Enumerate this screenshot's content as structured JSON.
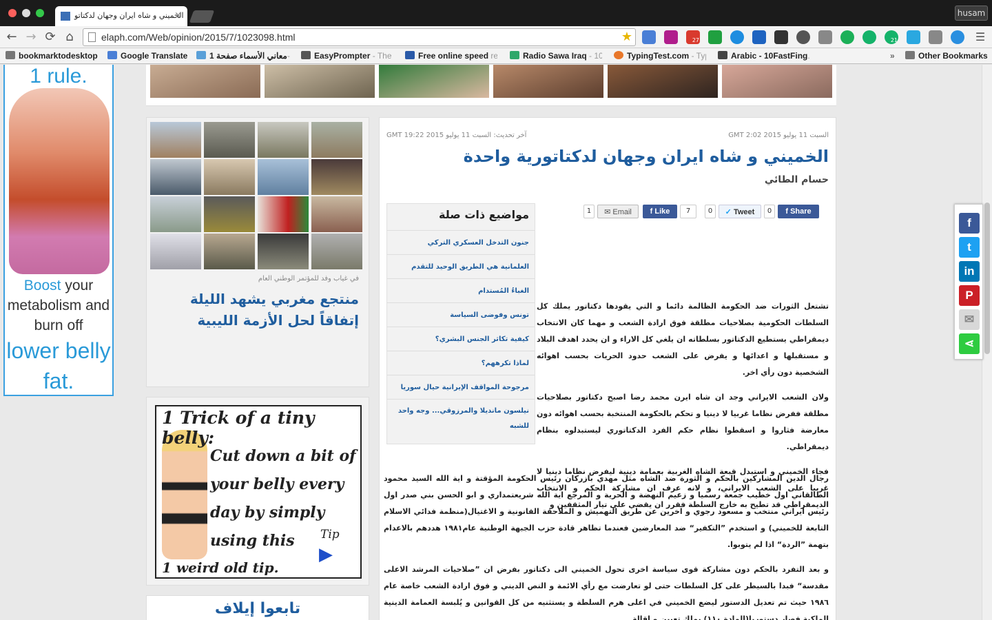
{
  "browser": {
    "tab_title": "الخميني و شاه ايران وجهان لدكتاتو",
    "tab_close": "×",
    "user_button": "husam",
    "url": "elaph.com/Web/opinion/2015/7/1023098.html",
    "back_glyph": "←",
    "forward_glyph": "→",
    "reload_glyph": "⟳",
    "home_glyph": "⌂",
    "star_glyph": "★",
    "extension_badges": {
      "gmail": "27",
      "grammarly": "21"
    },
    "icons": [
      "back-icon",
      "forward-icon",
      "reload-icon",
      "home-icon",
      "bookmark-star-icon",
      "menu-icon"
    ]
  },
  "bookmarks": {
    "items": [
      {
        "label": "bookmarktodesktop",
        "dim": ""
      },
      {
        "label": "Google Translate",
        "dim": ""
      },
      {
        "label": "معاني الأسماء صفحة 1",
        "dim": "- ..."
      },
      {
        "label": "EasyPrompter",
        "dim": " - The"
      },
      {
        "label": "Free online speed",
        "dim": " re"
      },
      {
        "label": "Radio Sawa Iraq",
        "dim": " - 10"
      },
      {
        "label": "TypingTest.com",
        "dim": " - Typ"
      },
      {
        "label": "Arabic - 10FastFing",
        "dim": "..."
      }
    ],
    "overflow": "»",
    "other": "Other Bookmarks"
  },
  "left_ad": {
    "line1": "1 rule.",
    "line2_blue": "Boost",
    "line2": " your metabolism and burn off",
    "line3": "lower belly fat."
  },
  "left_panel": {
    "caption": "في غياب وفد للمؤتمر الوطني العام",
    "headline": "منتجع مغربي يشهد الليلة إتفاقاً لحل الأزمة الليبية"
  },
  "mid_ad": {
    "line1": "1 Trick of a tiny belly:",
    "line2": "Cut down a bit of your belly every day by simply using this",
    "tip": "Tip",
    "line3": "1 weird old tip."
  },
  "follow": {
    "label": "تابعوا إيلاف"
  },
  "article": {
    "published": "السبت 11 يوليو 2015 GMT 2:02",
    "updated": "آخر تحديث: السبت 11 يوليو 2015 GMT 19:22",
    "title": "الخميني و شاه ايران وجهان لدكتاتورية واحدة",
    "author": "حسام الطائي",
    "share": {
      "share_label": "Share",
      "share_count": "0",
      "tweet_label": "Tweet",
      "tweet_count": "0",
      "like_label": "Like",
      "like_count": "7",
      "email_label": "Email",
      "email_count": "1"
    },
    "related": {
      "heading": "مواضيع ذات صلة",
      "items": [
        "جنون التدخل العسكري التركي",
        "العلمانية هي الطريق الوحيد للتقدم",
        "الغباءُ المُستدام",
        "تونس وفوضى السياسة",
        "كيفية تكاثر الجنس البشري؟",
        "لماذا تكرههم؟",
        "مرجوحة المواقف الإيرانية حيال سوريا",
        "نيلسون مانديلا والمرزوقي... وجه واحد للشبه"
      ]
    },
    "paragraphs_narrow": [
      "تشتعل الثورات ضد الحكومة الظالمة دائما و التي يقودها دكتاتور يملك كل السلطات الحكومية بصلاحيات مطلقة فوق ارادة الشعب و مهما كان الانتخاب ديمقراطي يستطيع الدكتاتور بسلطاته ان يلغي كل الاراء و ان يحدد اهدف البلاد و مستقبلها و اعدائها و يفرض على الشعب حدود الحريات بحسب اهوائه الشخصية دون رأي اخر.",
      "ولان الشعب الايراني وجد ان شاه ايرن محمد رضا اصبح دكتاتور بصلاحيات مطلقة ففرض نظاما غربيا لا دينيا و تحكم بالحكومة المنتخبة بحسب اهوائه دون معارضة فثاروا و اسقطوا نظام حكم الفرد الدكتاتوري ليستبدلوه بنظام ديمقراطي."
    ],
    "paragraph3_narrow": "فجاء الخميني و استبدل قبعة الشاه الغربية بعمامة دينية ليفرض نظاما دينيا لا غربيا على الشعب الايراني، و لانه عرف ان مشاركة الحكم و الانتخاب الديمقراطي قد تطيح به خارج السلطة فقرر ان يقضي على تيار المثقفين و",
    "paragraphs_wide": [
      "رجال الدين المشاركين بالحكم و الثورة ضد الشاه مثل مهدي بازركان رئيس الحكومة المؤقتة و اية الله السيد محمود الطالقاني اول خطيب جمعة رسميا و زعيم النهضة و الحرية و المرجع اية الله شريعتمداري و ابو الحسن بني صدر اول رئيس ايراني منتخب و مسعود رجوي و اخرين عن طريق التهميش و الملاحقة القانونية و الاغتيال(منظمة فدائي الاسلام التابعة للخميني) و استخدم ”التكفير“ ضد المعارضين فعندما تظاهر قادة حزب الجبهة الوطنية عام١٩٨١ هددهم بالاعدام بتهمة ”الردة“ اذا لم يتوبوا.",
      "و بعد التفرد بالحكم دون مشاركة قوى سياسة اخرى تحول الخميني الى دكتاتور بفرض ان ”صلاحيات المرشد الاعلى مقدسة“ فبدا بالسيطر على كل السلطات حتى لو تعارضت مع رأي الائمة و النص الديني و فوق ارادة الشعب خاصة عام ١٩٨٦ حيث تم تعديل الدستور ليضع الخميني في اعلى هرم السلطة و يستثنيه من كل القوانين و يُلبسة العمامة الدينية الملكية فصار دستوريا(المادة ١١٠) يملك تعيين و اقالة"
    ]
  },
  "sharebar": {
    "facebook": "f",
    "twitter": "t",
    "linkedin": "in",
    "pinterest": "P",
    "email": "✉",
    "share": "⋖"
  },
  "colors": {
    "headline_blue": "#1f5d9e",
    "facebook": "#3b5998",
    "twitter": "#1da1f2",
    "linkedin": "#0077b5",
    "pinterest": "#cb2027",
    "share_green": "#2ecc40"
  }
}
